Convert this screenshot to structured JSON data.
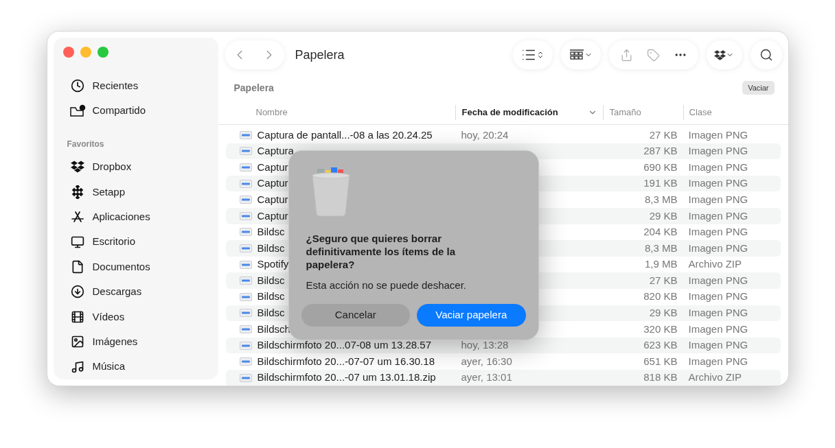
{
  "window": {
    "title": "Papelera"
  },
  "sidebar": {
    "items": [
      {
        "label": "Recientes"
      },
      {
        "label": "Compartido"
      }
    ],
    "section_title": "Favoritos",
    "favorites": [
      {
        "label": "Dropbox"
      },
      {
        "label": "Setapp"
      },
      {
        "label": "Aplicaciones"
      },
      {
        "label": "Escritorio"
      },
      {
        "label": "Documentos"
      },
      {
        "label": "Descargas"
      },
      {
        "label": "Vídeos"
      },
      {
        "label": "Imágenes"
      },
      {
        "label": "Música"
      }
    ]
  },
  "path_bar": {
    "title": "Papelera",
    "button": "Vaciar"
  },
  "table": {
    "columns": [
      {
        "label": "Nombre",
        "sorted": false
      },
      {
        "label": "Fecha de modificación",
        "sorted": true
      },
      {
        "label": "Tamaño",
        "sorted": false
      },
      {
        "label": "Clase",
        "sorted": false
      }
    ],
    "rows": [
      {
        "name": "Captura de pantall...-08 a las 20.24.25",
        "date": "hoy, 20:24",
        "size": "27 KB",
        "kind": "Imagen PNG"
      },
      {
        "name": "Captura",
        "size": "287 KB",
        "kind": "Imagen PNG"
      },
      {
        "name": "Captur",
        "size": "690 KB",
        "kind": "Imagen PNG"
      },
      {
        "name": "Captur",
        "size": "191 KB",
        "kind": "Imagen PNG"
      },
      {
        "name": "Captur",
        "size": "8,3 MB",
        "kind": "Imagen PNG"
      },
      {
        "name": "Captur",
        "size": "29 KB",
        "kind": "Imagen PNG"
      },
      {
        "name": "Bildsc",
        "size": "204 KB",
        "kind": "Imagen PNG"
      },
      {
        "name": "Bildsc",
        "size": "8,3 MB",
        "kind": "Imagen PNG"
      },
      {
        "name": "Spotify",
        "size": "1,9 MB",
        "kind": "Archivo ZIP"
      },
      {
        "name": "Bildsc",
        "size": "27 KB",
        "kind": "Imagen PNG"
      },
      {
        "name": "Bildsc",
        "size": "820 KB",
        "kind": "Imagen PNG"
      },
      {
        "name": "Bildsc",
        "size": "29 KB",
        "kind": "Imagen PNG"
      },
      {
        "name": "Bildsch",
        "size": "320 KB",
        "kind": "Imagen PNG"
      },
      {
        "name": "Bildschirmfoto 20...07-08 um 13.28.57",
        "date": "hoy, 13:28",
        "size": "623 KB",
        "kind": "Imagen PNG"
      },
      {
        "name": "Bildschirmfoto 20...-07-07 um 16.30.18",
        "date": "ayer, 16:30",
        "size": "651 KB",
        "kind": "Imagen PNG"
      },
      {
        "name": "Bildschirmfoto 20...-07 um 13.01.18.zip",
        "date": "ayer, 13:01",
        "size": "818 KB",
        "kind": "Archivo ZIP"
      }
    ]
  },
  "dialog": {
    "title": "¿Seguro que quieres borrar definitivamente los ítems de la papelera?",
    "message": "Esta acción no se puede deshacer.",
    "buttons": [
      {
        "label": "Cancelar",
        "kind": "secondary"
      },
      {
        "label": "Vaciar papelera",
        "kind": "primary"
      }
    ]
  }
}
